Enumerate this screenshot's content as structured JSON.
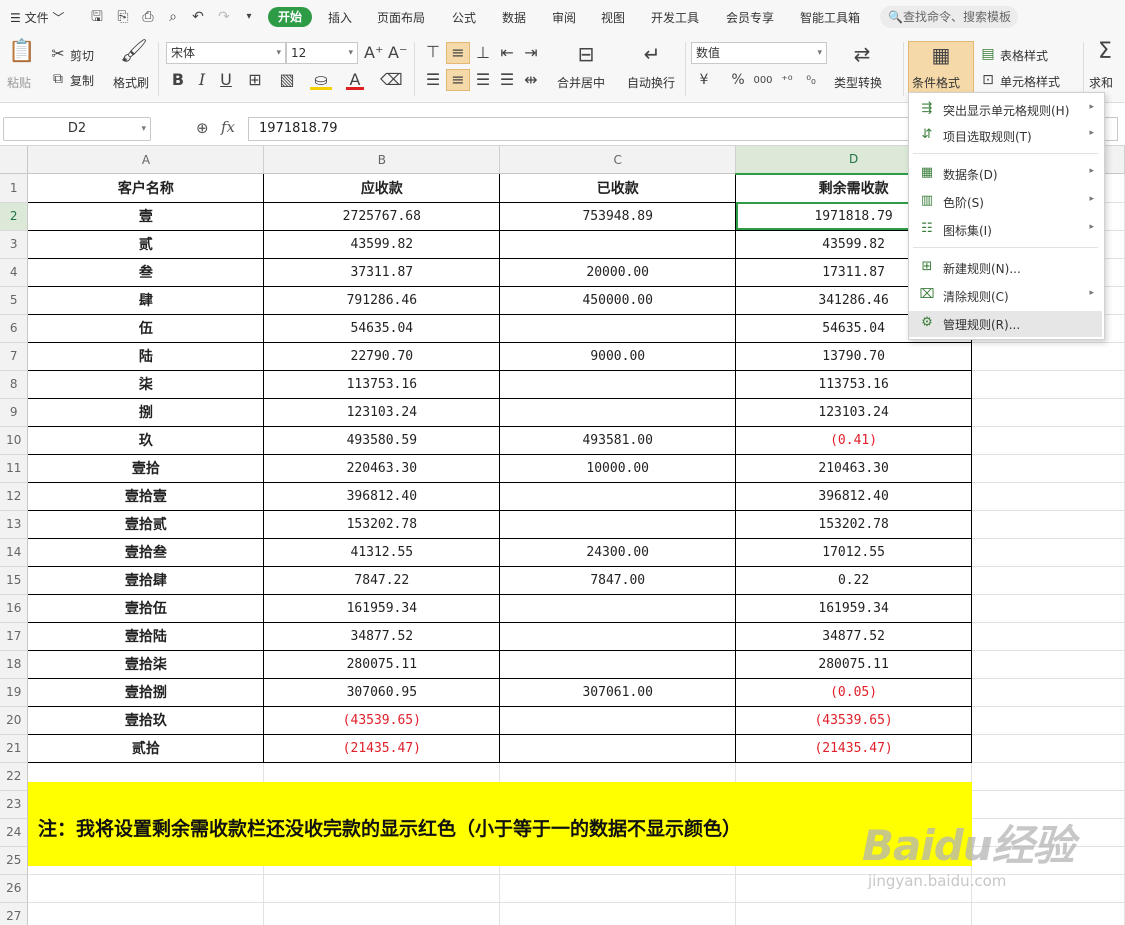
{
  "menubar": {
    "file": "文件",
    "tabs": [
      "开始",
      "插入",
      "页面布局",
      "公式",
      "数据",
      "审阅",
      "视图",
      "开发工具",
      "会员专享",
      "智能工具箱"
    ],
    "search_placeholder": "查找命令、搜索模板"
  },
  "ribbon": {
    "paste": "粘贴",
    "cut": "剪切",
    "copy": "复制",
    "format_painter": "格式刷",
    "font_name": "宋体",
    "font_size": "12",
    "number_format": "数值",
    "merge_center": "合并居中",
    "wrap_text": "自动换行",
    "type_convert": "类型转换",
    "conditional_format": "条件格式",
    "table_style": "表格样式",
    "cell_style": "单元格样式",
    "sum": "求和",
    "currency_symbol": "¥",
    "percent_symbol": "%",
    "thousands": "000"
  },
  "formula_bar": {
    "name_box": "D2",
    "fx": "fx",
    "value": "1971818.79"
  },
  "sheet": {
    "columns": [
      "A",
      "B",
      "C",
      "D"
    ],
    "selected_column": "D",
    "selected_row": 2,
    "headers": [
      "客户名称",
      "应收款",
      "已收款",
      "剩余需收款"
    ],
    "rows": [
      {
        "n": "2",
        "name": "壹",
        "b": "2725767.68",
        "c": "753948.89",
        "d": "1971818.79",
        "b_neg": false,
        "d_neg": false
      },
      {
        "n": "3",
        "name": "贰",
        "b": "43599.82",
        "c": "",
        "d": "43599.82",
        "b_neg": false,
        "d_neg": false
      },
      {
        "n": "4",
        "name": "叁",
        "b": "37311.87",
        "c": "20000.00",
        "d": "17311.87",
        "b_neg": false,
        "d_neg": false
      },
      {
        "n": "5",
        "name": "肆",
        "b": "791286.46",
        "c": "450000.00",
        "d": "341286.46",
        "b_neg": false,
        "d_neg": false
      },
      {
        "n": "6",
        "name": "伍",
        "b": "54635.04",
        "c": "",
        "d": "54635.04",
        "b_neg": false,
        "d_neg": false
      },
      {
        "n": "7",
        "name": "陆",
        "b": "22790.70",
        "c": "9000.00",
        "d": "13790.70",
        "b_neg": false,
        "d_neg": false
      },
      {
        "n": "8",
        "name": "柒",
        "b": "113753.16",
        "c": "",
        "d": "113753.16",
        "b_neg": false,
        "d_neg": false
      },
      {
        "n": "9",
        "name": "捌",
        "b": "123103.24",
        "c": "",
        "d": "123103.24",
        "b_neg": false,
        "d_neg": false
      },
      {
        "n": "10",
        "name": "玖",
        "b": "493580.59",
        "c": "493581.00",
        "d": "(0.41)",
        "b_neg": false,
        "d_neg": true
      },
      {
        "n": "11",
        "name": "壹拾",
        "b": "220463.30",
        "c": "10000.00",
        "d": "210463.30",
        "b_neg": false,
        "d_neg": false
      },
      {
        "n": "12",
        "name": "壹拾壹",
        "b": "396812.40",
        "c": "",
        "d": "396812.40",
        "b_neg": false,
        "d_neg": false
      },
      {
        "n": "13",
        "name": "壹拾贰",
        "b": "153202.78",
        "c": "",
        "d": "153202.78",
        "b_neg": false,
        "d_neg": false
      },
      {
        "n": "14",
        "name": "壹拾叁",
        "b": "41312.55",
        "c": "24300.00",
        "d": "17012.55",
        "b_neg": false,
        "d_neg": false
      },
      {
        "n": "15",
        "name": "壹拾肆",
        "b": "7847.22",
        "c": "7847.00",
        "d": "0.22",
        "b_neg": false,
        "d_neg": false
      },
      {
        "n": "16",
        "name": "壹拾伍",
        "b": "161959.34",
        "c": "",
        "d": "161959.34",
        "b_neg": false,
        "d_neg": false
      },
      {
        "n": "17",
        "name": "壹拾陆",
        "b": "34877.52",
        "c": "",
        "d": "34877.52",
        "b_neg": false,
        "d_neg": false
      },
      {
        "n": "18",
        "name": "壹拾柒",
        "b": "280075.11",
        "c": "",
        "d": "280075.11",
        "b_neg": false,
        "d_neg": false
      },
      {
        "n": "19",
        "name": "壹拾捌",
        "b": "307060.95",
        "c": "307061.00",
        "d": "(0.05)",
        "b_neg": false,
        "d_neg": true
      },
      {
        "n": "20",
        "name": "壹拾玖",
        "b": "(43539.65)",
        "c": "",
        "d": "(43539.65)",
        "b_neg": true,
        "d_neg": true
      },
      {
        "n": "21",
        "name": "贰拾",
        "b": "(21435.47)",
        "c": "",
        "d": "(21435.47)",
        "b_neg": true,
        "d_neg": true
      }
    ],
    "trailing_rows": [
      "22",
      "23",
      "24",
      "25",
      "26",
      "27"
    ],
    "note": "注：我将设置剩余需收款栏还没收完款的显示红色（小于等于一的数据不显示颜色）",
    "negative_color": "#e0202a",
    "note_background": "#ffff00",
    "selection_color": "#2e9b47"
  },
  "dropdown": {
    "items": [
      {
        "label": "突出显示单元格规则(H)",
        "submenu": true,
        "icon": "highlight-rules-icon"
      },
      {
        "label": "项目选取规则(T)",
        "submenu": true,
        "icon": "top-bottom-rules-icon"
      },
      {
        "label": "数据条(D)",
        "submenu": true,
        "icon": "data-bars-icon"
      },
      {
        "label": "色阶(S)",
        "submenu": true,
        "icon": "color-scale-icon"
      },
      {
        "label": "图标集(I)",
        "submenu": true,
        "icon": "icon-sets-icon"
      },
      {
        "label": "新建规则(N)...",
        "submenu": false,
        "icon": "new-rule-icon"
      },
      {
        "label": "清除规则(C)",
        "submenu": true,
        "icon": "clear-rules-icon"
      },
      {
        "label": "管理规则(R)...",
        "submenu": false,
        "icon": "manage-rules-icon"
      }
    ]
  },
  "watermark": {
    "brand": "Baidu经验",
    "url": "jingyan.baidu.com"
  }
}
